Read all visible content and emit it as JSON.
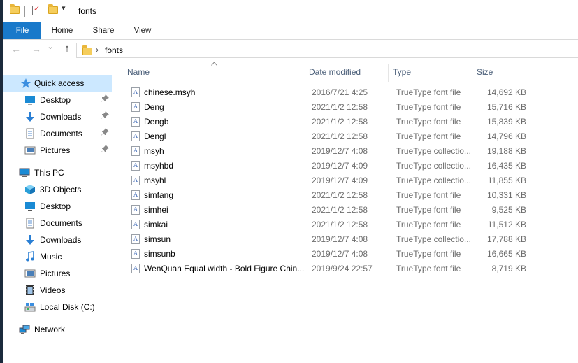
{
  "window": {
    "title": "fonts"
  },
  "ribbon": {
    "tabs": [
      "File",
      "Home",
      "Share",
      "View"
    ]
  },
  "address": {
    "crumb": "fonts",
    "chevron": "›"
  },
  "icons": {
    "back": "←",
    "forward": "→",
    "recent": "⌄",
    "up": "↑",
    "pin": "📌",
    "qa_dropdown": "▾"
  },
  "sidebar": {
    "items": [
      {
        "label": "Quick access",
        "icon": "star-icon",
        "pinned": false,
        "selected": true
      },
      {
        "label": "Desktop",
        "icon": "desktop-icon",
        "pinned": true
      },
      {
        "label": "Downloads",
        "icon": "download-icon",
        "pinned": true
      },
      {
        "label": "Documents",
        "icon": "documents-icon",
        "pinned": true
      },
      {
        "label": "Pictures",
        "icon": "pictures-icon",
        "pinned": true
      },
      {
        "label": "This PC",
        "icon": "computer-icon"
      },
      {
        "label": "3D Objects",
        "icon": "cube-icon"
      },
      {
        "label": "Desktop",
        "icon": "desktop-icon"
      },
      {
        "label": "Documents",
        "icon": "documents-icon"
      },
      {
        "label": "Downloads",
        "icon": "download-icon"
      },
      {
        "label": "Music",
        "icon": "music-icon"
      },
      {
        "label": "Pictures",
        "icon": "pictures-icon"
      },
      {
        "label": "Videos",
        "icon": "video-icon"
      },
      {
        "label": "Local Disk (C:)",
        "icon": "disk-icon"
      },
      {
        "label": "Network",
        "icon": "network-icon"
      }
    ]
  },
  "columns": {
    "name": "Name",
    "date": "Date modified",
    "type": "Type",
    "size": "Size"
  },
  "files": [
    {
      "name": "chinese.msyh",
      "date": "2016/7/21 4:25",
      "type": "TrueType font file",
      "size": "14,692 KB"
    },
    {
      "name": "Deng",
      "date": "2021/1/2 12:58",
      "type": "TrueType font file",
      "size": "15,716 KB"
    },
    {
      "name": "Dengb",
      "date": "2021/1/2 12:58",
      "type": "TrueType font file",
      "size": "15,839 KB"
    },
    {
      "name": "Dengl",
      "date": "2021/1/2 12:58",
      "type": "TrueType font file",
      "size": "14,796 KB"
    },
    {
      "name": "msyh",
      "date": "2019/12/7 4:08",
      "type": "TrueType collectio...",
      "size": "19,188 KB"
    },
    {
      "name": "msyhbd",
      "date": "2019/12/7 4:09",
      "type": "TrueType collectio...",
      "size": "16,435 KB"
    },
    {
      "name": "msyhl",
      "date": "2019/12/7 4:09",
      "type": "TrueType collectio...",
      "size": "11,855 KB"
    },
    {
      "name": "simfang",
      "date": "2021/1/2 12:58",
      "type": "TrueType font file",
      "size": "10,331 KB"
    },
    {
      "name": "simhei",
      "date": "2021/1/2 12:58",
      "type": "TrueType font file",
      "size": "9,525 KB"
    },
    {
      "name": "simkai",
      "date": "2021/1/2 12:58",
      "type": "TrueType font file",
      "size": "11,512 KB"
    },
    {
      "name": "simsun",
      "date": "2019/12/7 4:08",
      "type": "TrueType collectio...",
      "size": "17,788 KB"
    },
    {
      "name": "simsunb",
      "date": "2019/12/7 4:08",
      "type": "TrueType font file",
      "size": "16,665 KB"
    },
    {
      "name": "WenQuan Equal width - Bold Figure Chin...",
      "date": "2019/9/24 22:57",
      "type": "TrueType font file",
      "size": "8,719 KB"
    }
  ],
  "file_icon_glyph": "A"
}
